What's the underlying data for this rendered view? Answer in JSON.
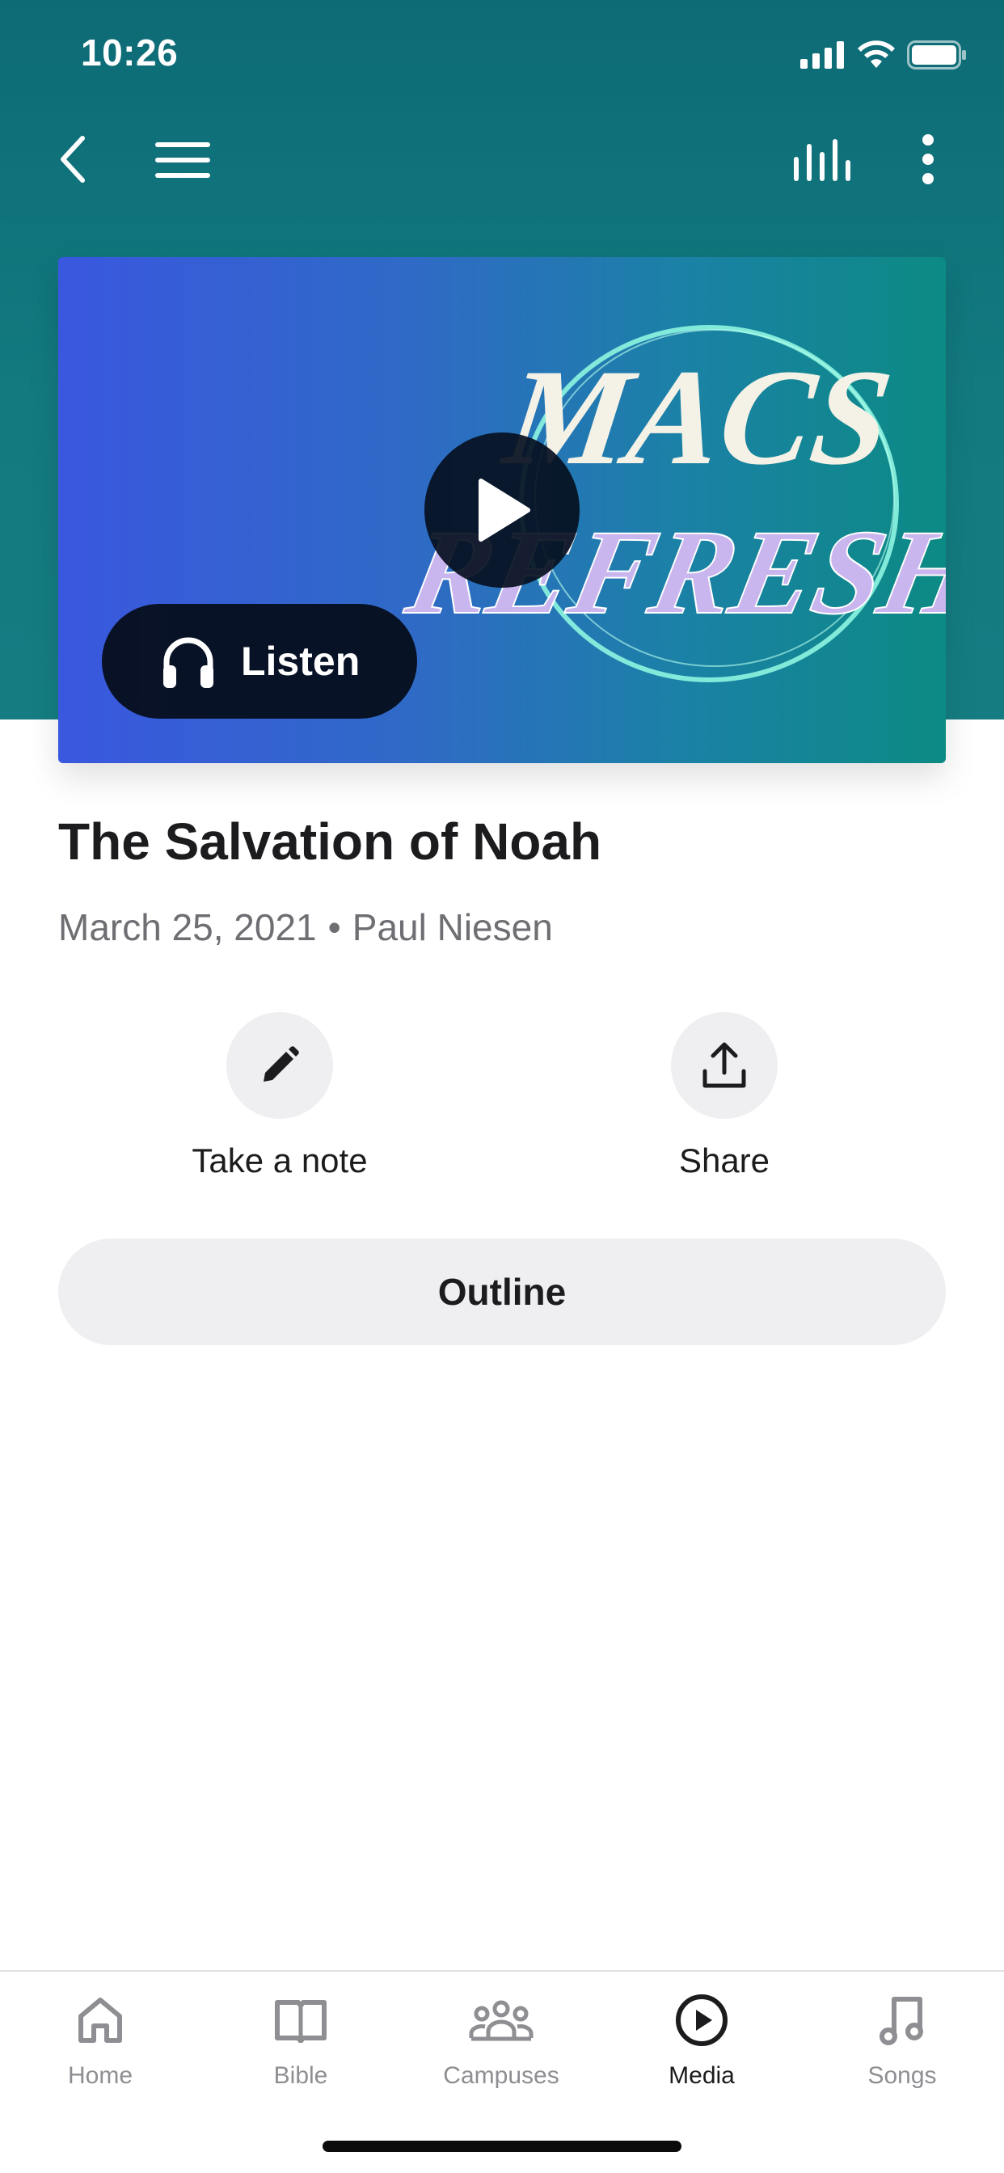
{
  "status_bar": {
    "time": "10:26"
  },
  "nav": {
    "back_icon": "chevron-left-icon",
    "menu_icon": "hamburger-menu-icon",
    "audio_icon": "audio-bars-icon",
    "more_icon": "vertical-dots-icon"
  },
  "artwork": {
    "line1": "MACS",
    "line2": "REFRESH",
    "listen_label": "Listen",
    "play_icon": "play-icon",
    "headphones_icon": "headphones-icon"
  },
  "sermon": {
    "title": "The Salvation of Noah",
    "date": "March 25, 2021",
    "separator": "•",
    "speaker": "Paul Niesen"
  },
  "actions": {
    "note_label": "Take a note",
    "share_label": "Share"
  },
  "outline_label": "Outline",
  "tabs": [
    {
      "label": "Home",
      "icon": "home-icon",
      "active": false
    },
    {
      "label": "Bible",
      "icon": "book-icon",
      "active": false
    },
    {
      "label": "Campuses",
      "icon": "people-icon",
      "active": false
    },
    {
      "label": "Media",
      "icon": "play-circle-icon",
      "active": true
    },
    {
      "label": "Songs",
      "icon": "music-note-icon",
      "active": false
    }
  ],
  "colors": {
    "header": "#0d6b76",
    "artwork_start": "#3a57df",
    "artwork_end": "#0c8a84",
    "text_primary": "#1c1c1e",
    "text_secondary": "#6e6e73"
  }
}
